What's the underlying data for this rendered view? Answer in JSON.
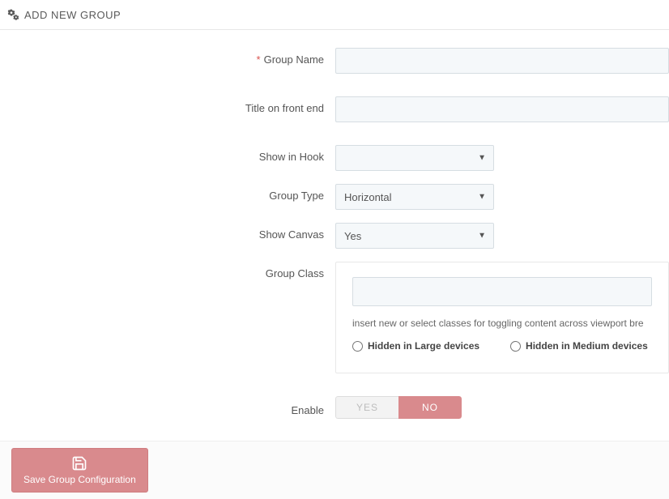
{
  "header": {
    "title": "ADD NEW GROUP"
  },
  "form": {
    "group_name": {
      "label": "Group Name",
      "required": true,
      "value": ""
    },
    "title_front_end": {
      "label": "Title on front end",
      "value": ""
    },
    "show_in_hook": {
      "label": "Show in Hook",
      "selected": ""
    },
    "group_type": {
      "label": "Group Type",
      "selected": "Horizontal"
    },
    "show_canvas": {
      "label": "Show Canvas",
      "selected": "Yes"
    },
    "group_class": {
      "label": "Group Class",
      "value": "",
      "hint": "insert new or select classes for toggling content across viewport bre",
      "radios": {
        "large": "Hidden in Large devices",
        "medium": "Hidden in Medium devices"
      }
    },
    "enable": {
      "label": "Enable",
      "yes": "YES",
      "no": "NO",
      "value": "NO"
    }
  },
  "footer": {
    "save_label": "Save Group Configuration"
  }
}
